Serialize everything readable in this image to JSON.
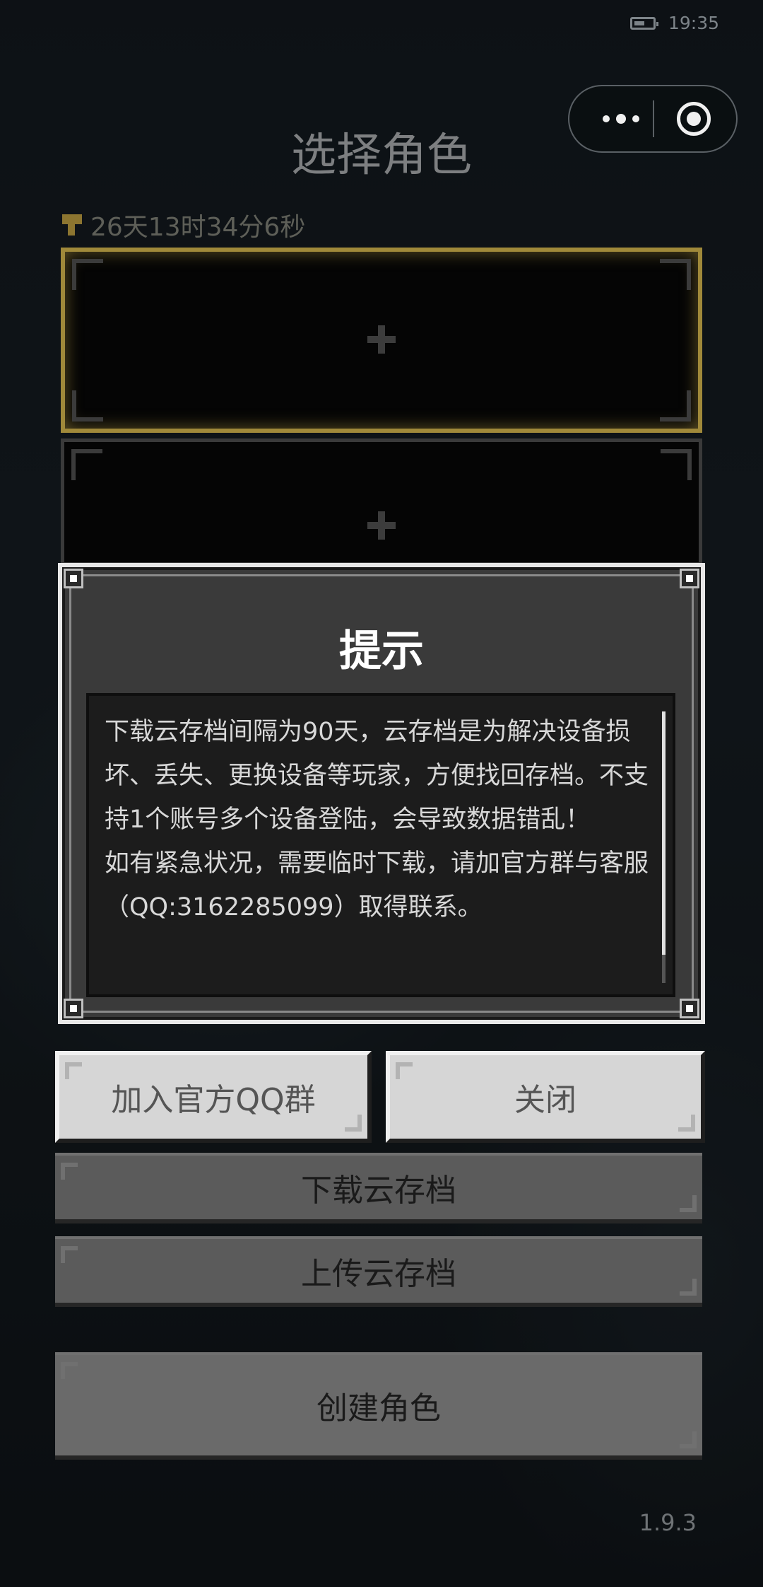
{
  "status_bar": {
    "time": "19:35",
    "battery_icon": "battery-icon"
  },
  "capsule": {
    "more_icon": "more-dots-icon",
    "close_icon": "mini-program-close-icon"
  },
  "page": {
    "title": "选择角色",
    "timer": "26天13时34分6秒",
    "timer_icon": "key-icon"
  },
  "slots": [
    {
      "state": "selected",
      "icon": "plus-icon"
    },
    {
      "state": "empty",
      "icon": "plus-icon"
    }
  ],
  "dialog": {
    "title": "提示",
    "paragraphs": [
      "下载云存档间隔为90天，云存档是为解决设备损坏、丢失、更换设备等玩家，方便找回存档。不支持1个账号多个设备登陆，会导致数据错乱！",
      "如有紧急状况，需要临时下载，请加官方群与客服（QQ:3162285099）取得联系。"
    ]
  },
  "buttons": {
    "join_qq": "加入官方QQ群",
    "close": "关闭",
    "download": "下载云存档",
    "upload": "上传云存档",
    "create": "创建角色"
  },
  "version": "1.9.3",
  "colors": {
    "selected_border": "#a0893a",
    "dialog_bg": "#3a3a3a"
  }
}
